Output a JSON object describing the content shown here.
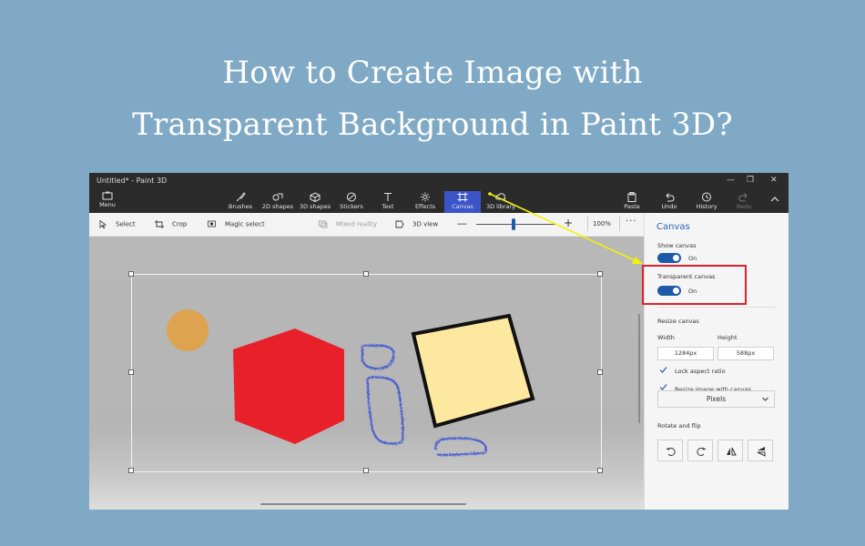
{
  "headline": {
    "line1": "How to Create Image with",
    "line2": "Transparent Background in Paint 3D?"
  },
  "window": {
    "title": "Untitled* - Paint 3D"
  },
  "toolbar": {
    "menu": "Menu",
    "tools": [
      "Brushes",
      "2D shapes",
      "3D shapes",
      "Stickers",
      "Text",
      "Effects",
      "Canvas",
      "3D library"
    ],
    "paste": "Paste",
    "undo": "Undo",
    "history": "History",
    "redo": "Redo"
  },
  "options_bar": {
    "select": "Select",
    "crop": "Crop",
    "magic_select": "Magic select",
    "mixed_reality": "Mixed reality",
    "view_3d": "3D view",
    "zoom": "100%",
    "more": "···",
    "zoom_level_fraction": 0.47
  },
  "panel": {
    "title": "Canvas",
    "show_canvas": {
      "label": "Show canvas",
      "state": "On"
    },
    "transparent_canvas": {
      "label": "Transparent canvas",
      "state": "On"
    },
    "resize_canvas": "Resize canvas",
    "width_label": "Width",
    "height_label": "Height",
    "width_value": "1284px",
    "height_value": "588px",
    "lock_aspect": "Lock aspect ratio",
    "resize_image": "Resize image with canvas",
    "units": "Pixels",
    "rotate_flip": "Rotate and flip"
  },
  "colors": {
    "accent": "#1f5aa8",
    "active_tool": "#3b55c9",
    "highlight_box": "#e0202a",
    "arrow": "#f2f20a",
    "hexagon": "#e8202a",
    "square_fill": "#fde8a0",
    "blob": "#e0a24a",
    "scribble": "#4a5fcf"
  }
}
